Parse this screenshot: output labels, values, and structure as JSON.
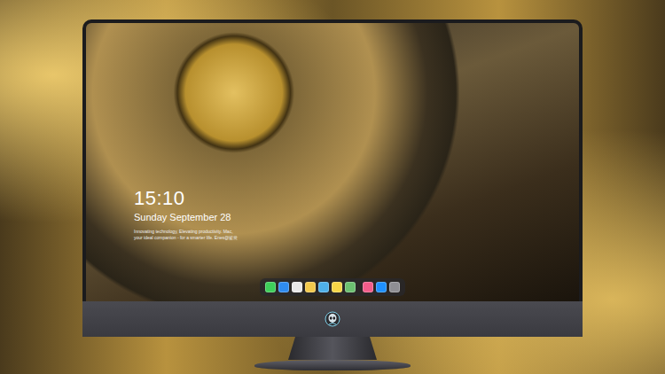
{
  "lock_screen": {
    "time": "15:10",
    "date": "Sunday September 28",
    "tagline": [
      "Innovating technology, Elevating productivity. Mac,",
      "your ideal companion - for a smarter life. Enes@鉴赏"
    ]
  },
  "dock": {
    "groups": [
      {
        "items": [
          {
            "color": "#3ecf5a"
          },
          {
            "color": "#2f8cf0"
          },
          {
            "color": "#e8e8e8"
          },
          {
            "color": "#f2c94c"
          },
          {
            "color": "#4fb0e8"
          },
          {
            "color": "#f5d547"
          },
          {
            "color": "#6cc070"
          }
        ]
      },
      {
        "items": [
          {
            "color": "#f25c8a"
          },
          {
            "color": "#1e90ff"
          },
          {
            "color": "#8e8e93"
          }
        ]
      }
    ]
  }
}
